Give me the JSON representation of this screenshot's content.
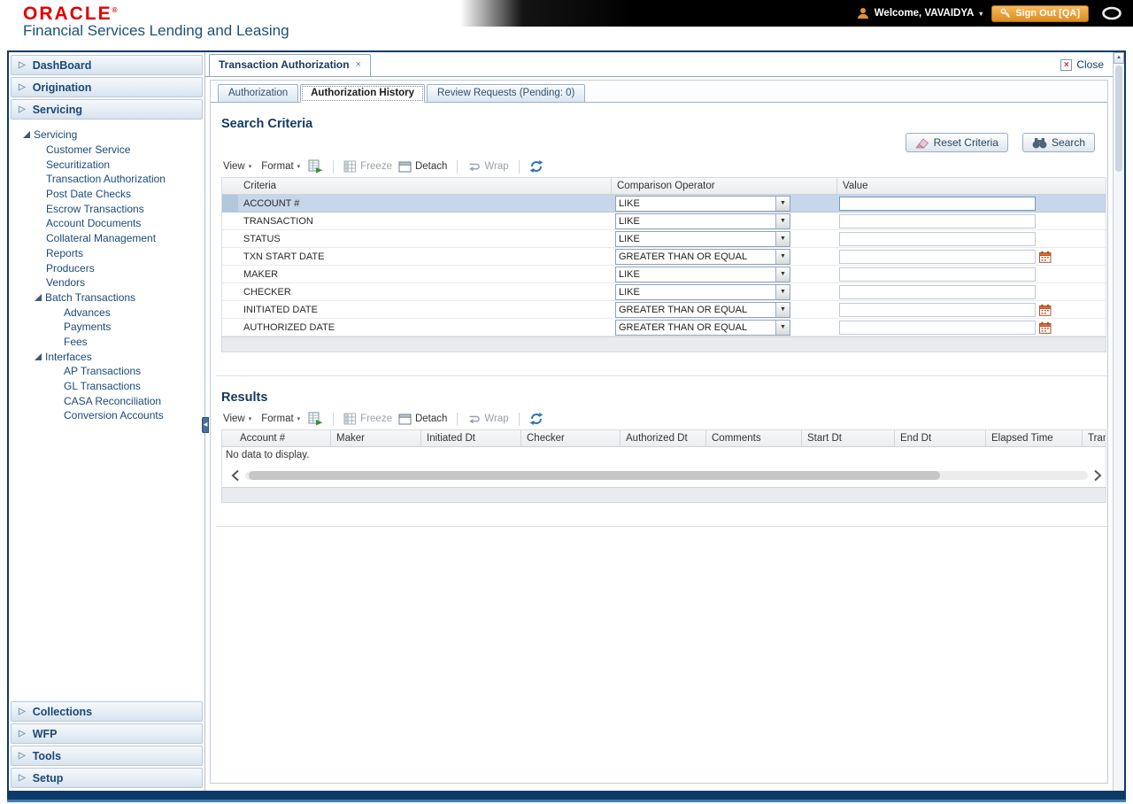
{
  "header": {
    "logo": "ORACLE",
    "registered": "®",
    "subtitle": "Financial Services Lending and Leasing",
    "welcome": "Welcome, VAVAIDYA",
    "sign_out": "Sign Out [QA]"
  },
  "sidebar": {
    "sections": [
      "DashBoard",
      "Origination",
      "Servicing",
      "Collections",
      "WFP",
      "Tools",
      "Setup"
    ],
    "tree": {
      "root": "Servicing",
      "items": [
        "Customer Service",
        "Securitization",
        "Transaction Authorization",
        "Post Date Checks",
        "Escrow Transactions",
        "Account Documents",
        "Collateral Management",
        "Reports",
        "Producers",
        "Vendors"
      ],
      "batch": {
        "label": "Batch Transactions",
        "children": [
          "Advances",
          "Payments",
          "Fees"
        ]
      },
      "interfaces": {
        "label": "Interfaces",
        "children": [
          "AP Transactions",
          "GL Transactions",
          "CASA Reconciliation",
          "Conversion Accounts"
        ]
      }
    }
  },
  "workspace": {
    "doc_tab": "Transaction Authorization",
    "close_label": "Close",
    "subtabs": [
      "Authorization",
      "Authorization History",
      "Review Requests (Pending: 0)"
    ]
  },
  "toolbar": {
    "view": "View",
    "format": "Format",
    "freeze": "Freeze",
    "detach": "Detach",
    "wrap": "Wrap"
  },
  "search": {
    "title": "Search Criteria",
    "reset_button": "Reset Criteria",
    "search_button": "Search",
    "columns": [
      "Criteria",
      "Comparison Operator",
      "Value"
    ],
    "rows": [
      {
        "criteria": "ACCOUNT #",
        "operator": "LIKE",
        "value": ""
      },
      {
        "criteria": "TRANSACTION",
        "operator": "LIKE",
        "value": ""
      },
      {
        "criteria": "STATUS",
        "operator": "LIKE",
        "value": ""
      },
      {
        "criteria": "TXN START DATE",
        "operator": "GREATER THAN OR EQUAL",
        "value": ""
      },
      {
        "criteria": "MAKER",
        "operator": "LIKE",
        "value": ""
      },
      {
        "criteria": "CHECKER",
        "operator": "LIKE",
        "value": ""
      },
      {
        "criteria": "INITIATED DATE",
        "operator": "GREATER THAN OR EQUAL",
        "value": ""
      },
      {
        "criteria": "AUTHORIZED DATE",
        "operator": "GREATER THAN OR EQUAL",
        "value": ""
      }
    ]
  },
  "results": {
    "title": "Results",
    "columns": [
      "Account #",
      "Maker",
      "Initiated Dt",
      "Checker",
      "Authorized Dt",
      "Comments",
      "Start Dt",
      "End Dt",
      "Elapsed Time",
      "Transac"
    ],
    "empty_message": "No data to display."
  }
}
